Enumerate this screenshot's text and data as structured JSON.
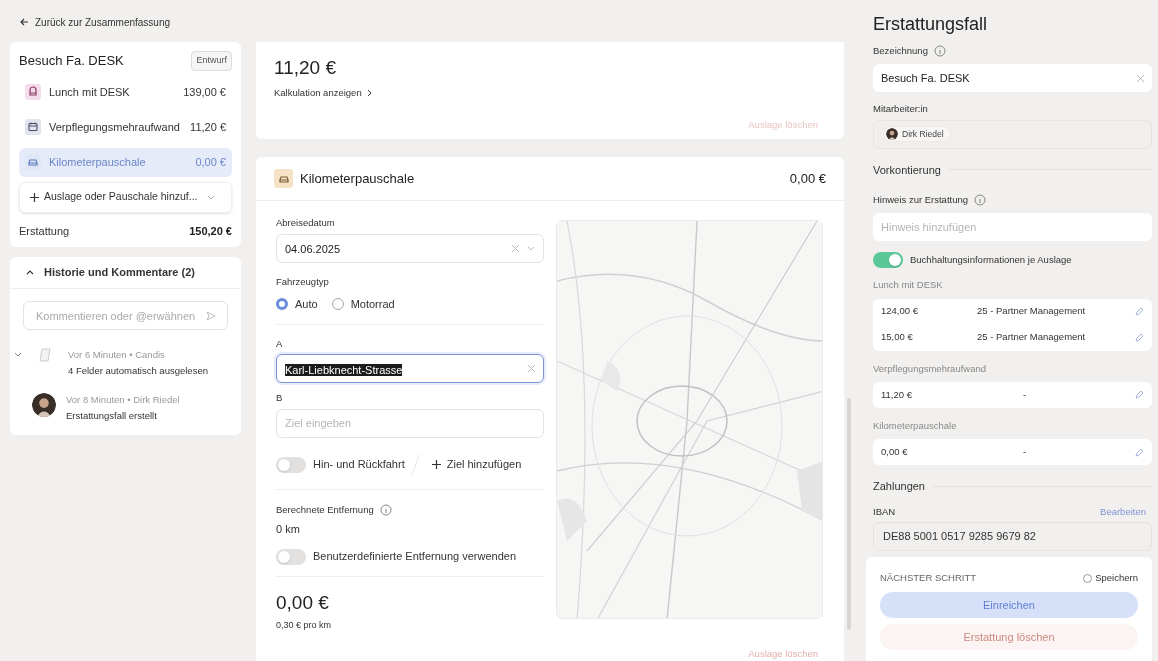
{
  "back_link": "Zurück zur Zusammenfassung",
  "summary": {
    "title": "Besuch Fa. DESK",
    "status": "Entwurf",
    "items": [
      {
        "kind": "meal",
        "label": "Lunch mit DESK",
        "amount": "139,00 €",
        "selected": false,
        "color": "#f5dcea"
      },
      {
        "kind": "calendar",
        "label": "Verpflegungsmehraufwand",
        "amount": "11,20 €",
        "selected": false,
        "color": "#e2e3ee"
      },
      {
        "kind": "car",
        "label": "Kilometerpauschale",
        "amount": "0,00 €",
        "selected": true,
        "color": "#dfe6f6"
      }
    ],
    "add_button": "Auslage oder Pauschale hinzuf...",
    "total_label": "Erstattung",
    "total_amount": "150,20 €"
  },
  "history": {
    "title": "Historie und Kommentare (2)",
    "expanded": true,
    "comment_placeholder": "Kommentieren oder @erwähnen",
    "entries": [
      {
        "kind": "system",
        "meta": "Vor 6 Minuten • Candis",
        "text": "4 Felder automatisch ausgelesen"
      },
      {
        "kind": "user",
        "meta": "Vor 8 Minuten • Dirk Riedel",
        "text": "Erstattungsfall erstellt"
      }
    ]
  },
  "previous_card": {
    "amount": "11,20 €",
    "link": "Kalkulation anzeigen",
    "delete": "Auslage löschen"
  },
  "mileage": {
    "title": "Kilometerpauschale",
    "amount": "0,00 €",
    "date_label": "Abreisedatum",
    "date_value": "04.06.2025",
    "vehicle_label": "Fahrzeugtyp",
    "vehicles": [
      {
        "label": "Auto",
        "selected": true
      },
      {
        "label": "Motorrad",
        "selected": false
      }
    ],
    "from_label": "A",
    "from_value": "Karl-Liebknecht-Strasse",
    "to_label": "B",
    "to_placeholder": "Ziel eingeben",
    "round_trip": {
      "label": "Hin- und Rückfahrt",
      "on": false
    },
    "add_destination": "Ziel hinzufügen",
    "distance_label": "Berechnete Entfernung",
    "distance_value": "0 km",
    "custom_distance": {
      "label": "Benutzerdefinierte Entfernung verwenden",
      "on": false
    },
    "total": "0,00 €",
    "rate": "0,30 € pro km",
    "delete": "Auslage löschen"
  },
  "panel": {
    "title": "Erstattungsfall",
    "name_label": "Bezeichnung",
    "name_value": "Besuch Fa. DESK",
    "employee_label": "Mitarbeiter:in",
    "employee": "Dirk Riedel",
    "section_accounting": "Vorkontierung",
    "note_label": "Hinweis zur Erstattung",
    "note_placeholder": "Hinweis hinzufügen",
    "per_expense": {
      "label": "Buchhaltungsinformationen je Auslage",
      "on": true
    },
    "groups": [
      {
        "title": "Lunch mit DESK",
        "rows": [
          {
            "amount": "124,00 €",
            "account": "25 - Partner Management"
          },
          {
            "amount": "15,00 €",
            "account": "25 - Partner Management"
          }
        ]
      },
      {
        "title": "Verpflegungsmehraufwand",
        "rows": [
          {
            "amount": "11,20 €",
            "account": "-"
          }
        ]
      },
      {
        "title": "Kilometerpauschale",
        "rows": [
          {
            "amount": "0,00 €",
            "account": "-"
          }
        ]
      }
    ],
    "section_payments": "Zahlungen",
    "iban_label": "IBAN",
    "iban_edit": "Bearbeiten",
    "iban": "DE88 5001 0517 9285 9679 82",
    "next_step": {
      "label": "NÄCHSTER SCHRITT",
      "save": "Speichern",
      "save_checked": false,
      "submit": "Einreichen",
      "delete": "Erstattung löschen"
    }
  }
}
